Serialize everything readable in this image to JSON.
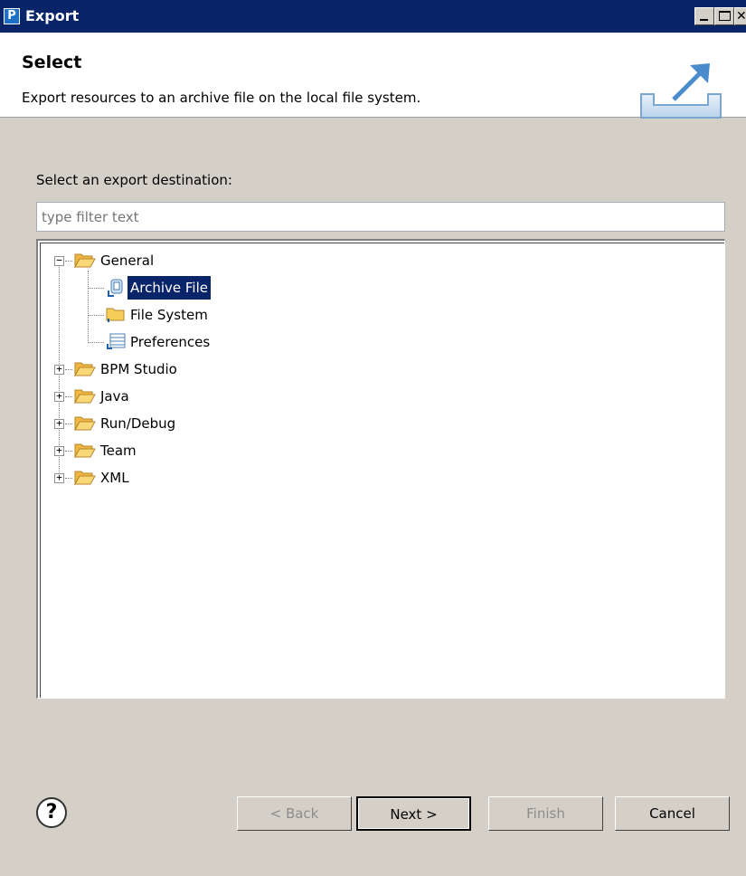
{
  "window": {
    "app_icon_letter": "P",
    "title": "Export"
  },
  "header": {
    "title": "Select",
    "description": "Export resources to an archive file on the local file system."
  },
  "content": {
    "destination_label": "Select an export destination:",
    "filter_placeholder": "type filter text",
    "tree": [
      {
        "label": "General",
        "expanded": true,
        "children": [
          {
            "label": "Archive File",
            "selected": true
          },
          {
            "label": "File System"
          },
          {
            "label": "Preferences"
          }
        ]
      },
      {
        "label": "BPM Studio",
        "expanded": false
      },
      {
        "label": "Java",
        "expanded": false
      },
      {
        "label": "Run/Debug",
        "expanded": false
      },
      {
        "label": "Team",
        "expanded": false
      },
      {
        "label": "XML",
        "expanded": false
      }
    ]
  },
  "footer": {
    "help_symbol": "?",
    "back_label": "< Back",
    "next_label": "Next >",
    "finish_label": "Finish",
    "cancel_label": "Cancel"
  },
  "colors": {
    "titlebar": "#0a246a",
    "selection": "#0a246a",
    "dialog_bg": "#d4d0c8",
    "folder": "#f5c64d"
  }
}
